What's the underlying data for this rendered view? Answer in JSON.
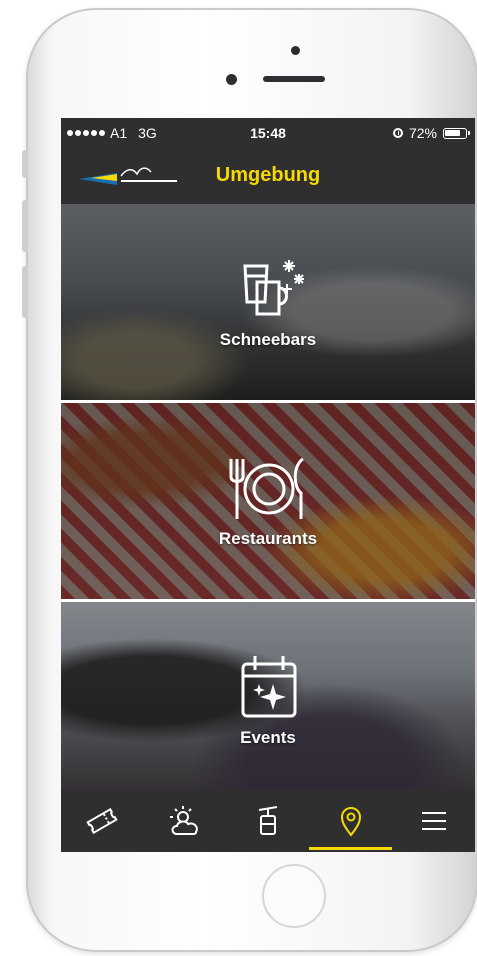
{
  "status_bar": {
    "carrier": "A1",
    "network": "3G",
    "time": "15:48",
    "battery": "72%"
  },
  "nav": {
    "title": "Umgebung",
    "logo_icon": "st-moritz-logo",
    "accent_color": "#f6d900"
  },
  "tiles": [
    {
      "label": "Schneebars",
      "icon": "snowbar-drinks-icon"
    },
    {
      "label": "Restaurants",
      "icon": "fork-plate-knife-icon"
    },
    {
      "label": "Events",
      "icon": "calendar-sparkle-icon"
    }
  ],
  "tabbar": {
    "items": [
      {
        "icon": "ticket-icon",
        "active": false
      },
      {
        "icon": "weather-sun-cloud-icon",
        "active": false
      },
      {
        "icon": "cable-car-icon",
        "active": false
      },
      {
        "icon": "location-pin-icon",
        "active": true
      },
      {
        "icon": "menu-icon",
        "active": false
      }
    ]
  }
}
